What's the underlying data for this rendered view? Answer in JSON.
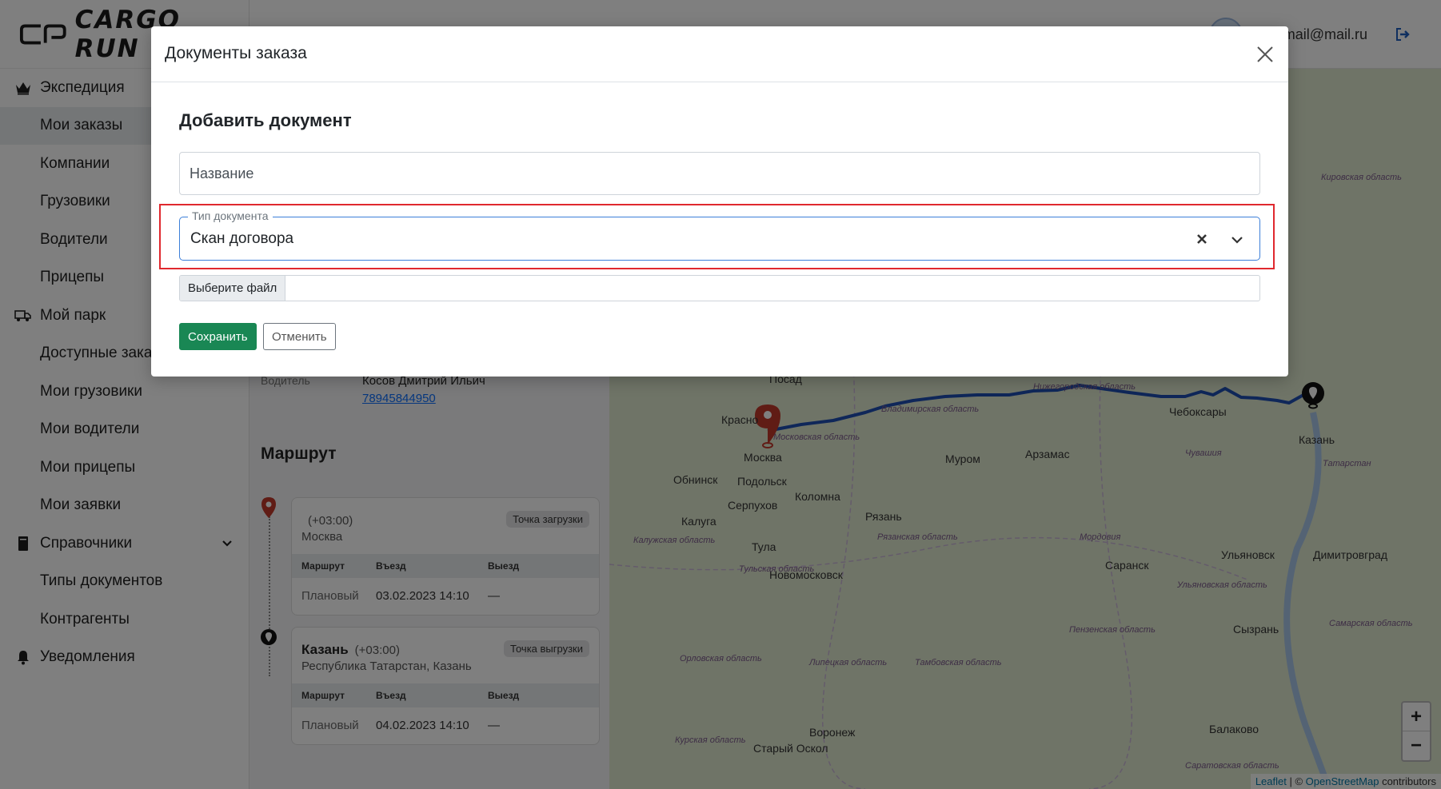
{
  "app": {
    "logo_text": "CARGO RUN",
    "user_email": "mail@mail.ru"
  },
  "sidebar": {
    "items": [
      {
        "label": "Экспедиция",
        "icon": "crown-icon",
        "type": "section"
      },
      {
        "label": "Мои заказы",
        "type": "sub",
        "active": true
      },
      {
        "label": "Компании",
        "type": "sub"
      },
      {
        "label": "Грузовики",
        "type": "sub"
      },
      {
        "label": "Водители",
        "type": "sub"
      },
      {
        "label": "Прицепы",
        "type": "sub"
      },
      {
        "label": "Мой парк",
        "icon": "truck-icon",
        "type": "section"
      },
      {
        "label": "Доступные заказы",
        "type": "sub"
      },
      {
        "label": "Мои грузовики",
        "type": "sub"
      },
      {
        "label": "Мои водители",
        "type": "sub"
      },
      {
        "label": "Мои прицепы",
        "type": "sub"
      },
      {
        "label": "Мои заявки",
        "type": "sub"
      },
      {
        "label": "Справочники",
        "icon": "book-icon",
        "type": "section"
      },
      {
        "label": "Типы документов",
        "type": "sub"
      },
      {
        "label": "Контрагенты",
        "type": "sub"
      },
      {
        "label": "Уведомления",
        "icon": "bell-icon",
        "type": "section"
      }
    ]
  },
  "order": {
    "driver_label": "Водитель",
    "driver_name": "Косов Дмитрий Ильич",
    "driver_phone": "78945844950",
    "route_title": "Маршрут",
    "route_header": {
      "col1": "Маршрут",
      "col2": "Въезд",
      "col3": "Выезд"
    },
    "points": [
      {
        "city": "",
        "tz": "(+03:00)",
        "address": "Москва",
        "badge": "Точка загрузки",
        "row": {
          "kind": "Плановый",
          "entry": "03.02.2023 14:10",
          "exit": "—"
        }
      },
      {
        "city": "Казань",
        "tz": "(+03:00)",
        "address": "Республика Татарстан, Казань",
        "badge": "Точка выгрузки",
        "row": {
          "kind": "Плановый",
          "entry": "04.02.2023 14:10",
          "exit": "—"
        }
      }
    ]
  },
  "map": {
    "labels": [
      "Москва",
      "Подольск",
      "Коломна",
      "Обнинск",
      "Серпухов",
      "Калуга",
      "Тула",
      "Новомосковск",
      "Рязань",
      "Муром",
      "Арзамас",
      "Саранск",
      "Чебоксары",
      "Казань",
      "Ульяновск",
      "Димитровград",
      "Сызрань",
      "Балаково",
      "Воронеж",
      "Старый Оскол",
      "Посад",
      "Красно"
    ],
    "regions": [
      "Московская область",
      "Владимирская область",
      "Нижегородская область",
      "Чувашия",
      "Татарстан",
      "Рязанская область",
      "Тульская область",
      "Калужская область",
      "Мордовия",
      "Ульяновская область",
      "Пензенская область",
      "Самарская область",
      "Липецкая область",
      "Тамбовская область",
      "Орловская область",
      "Курская область",
      "Саратовская область",
      "Кировская область"
    ],
    "zoom_in": "+",
    "zoom_out": "−",
    "attribution_leaflet": "Leaflet",
    "attribution_sep": " | © ",
    "attribution_osm": "OpenStreetMap",
    "attribution_rest": " contributors"
  },
  "modal": {
    "title": "Документы заказа",
    "form_title": "Добавить документ",
    "name_placeholder": "Название",
    "doc_type_legend": "Тип документа",
    "doc_type_value": "Скан договора",
    "file_button": "Выберите файл",
    "save_label": "Сохранить",
    "cancel_label": "Отменить"
  },
  "colors": {
    "accent": "#3c7fd9",
    "save": "#198754",
    "highlight": "#e0282e",
    "route": "#1f4fb3"
  }
}
